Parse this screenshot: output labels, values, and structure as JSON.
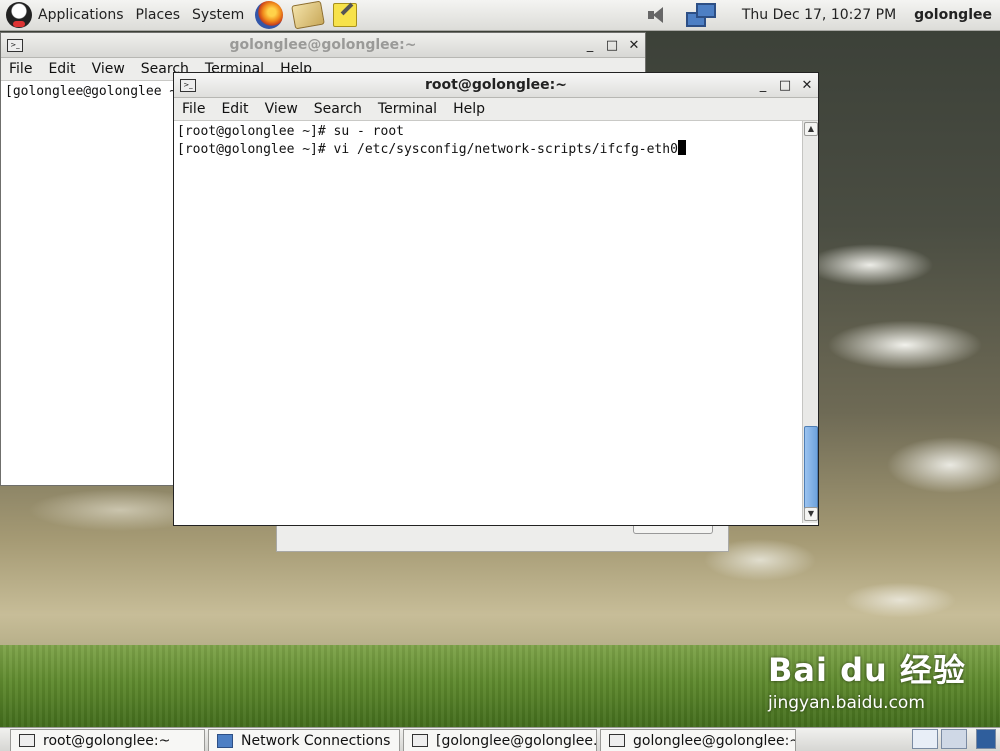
{
  "top_panel": {
    "menus": [
      "Applications",
      "Places",
      "System"
    ],
    "launchers": [
      "firefox-icon",
      "mail-icon",
      "notes-icon"
    ],
    "clock": "Thu Dec 17, 10:27 PM",
    "user": "golonglee"
  },
  "back_window": {
    "title": "golonglee@golonglee:~",
    "menu": [
      "File",
      "Edit",
      "View",
      "Search",
      "Terminal",
      "Help"
    ],
    "prompt": "[golonglee@golonglee ~"
  },
  "front_window": {
    "title": "root@golonglee:~",
    "menu": [
      "File",
      "Edit",
      "View",
      "Search",
      "Terminal",
      "Help"
    ],
    "lines": [
      "[root@golonglee ~]# su - root",
      "[root@golonglee ~]# vi /etc/sysconfig/network-scripts/ifcfg-eth0"
    ]
  },
  "taskbar": {
    "tasks": [
      "root@golonglee:~",
      "Network Connections",
      "[golonglee@golonglee...",
      "golonglee@golonglee:~"
    ]
  },
  "watermark": {
    "logo": "Bai du 经验",
    "url": "jingyan.baidu.com"
  },
  "colors": {
    "scroll_thumb": "#6ea3dd",
    "panel": "#dcdcd8"
  }
}
